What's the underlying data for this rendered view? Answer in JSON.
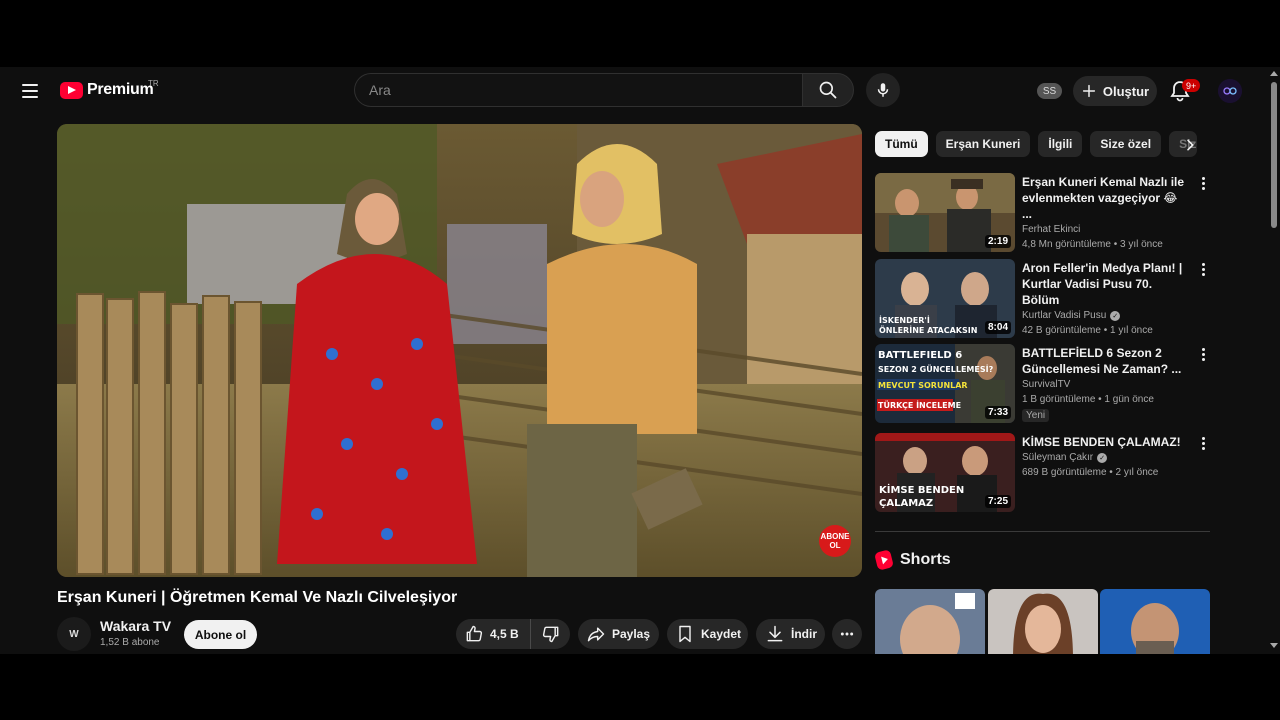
{
  "header": {
    "logo_text": "Premium",
    "country_code": "TR",
    "search_placeholder": "Ara",
    "ss_badge": "SS",
    "create_label": "Oluştur",
    "notification_count": "9+"
  },
  "video": {
    "title": "Erşan Kuneri | Öğretmen Kemal Ve Nazlı Cilveleşiyor",
    "channel_avatar_text": "W",
    "channel_name": "Wakara TV",
    "channel_subs": "1,52 B abone",
    "subscribe_label": "Abone ol",
    "watermark_line1": "ABONE",
    "watermark_line2": "OL",
    "like_count": "4,5 B",
    "share_label": "Paylaş",
    "save_label": "Kaydet",
    "download_label": "İndir"
  },
  "chips": [
    "Tümü",
    "Erşan Kuneri",
    "İlgili",
    "Size özel",
    "Sizin için"
  ],
  "recommendations": [
    {
      "title": "Erşan Kuneri Kemal Nazlı ile evlenmekten vazgeçiyor 😂 ...",
      "channel": "Ferhat Ekinci",
      "verified": false,
      "meta": "4,8 Mn görüntüleme • 3 yıl önce",
      "duration": "2:19",
      "badge": ""
    },
    {
      "title": "Aron Feller'in Medya Planı! | Kurtlar Vadisi Pusu 70. Bölüm",
      "channel": "Kurtlar Vadisi Pusu",
      "verified": true,
      "meta": "42 B görüntüleme • 1 yıl önce",
      "duration": "8:04",
      "badge": "",
      "thumb_text": "İSKENDER'İ ÖNLERİNE ATACAKSIN"
    },
    {
      "title": "BATTLEFİELD 6 Sezon 2 Güncellemesi Ne Zaman? ...",
      "channel": "SurvivalTV",
      "verified": false,
      "meta": "1 B görüntüleme • 1 gün önce",
      "duration": "7:33",
      "badge": "Yeni",
      "thumb_lines": [
        "BATTLEFIELD 6",
        "SEZON 2 GÜNCELLEMESİ?",
        "MEVCUT SORUNLAR",
        "TÜRKÇE İNCELEME"
      ]
    },
    {
      "title": "KİMSE BENDEN ÇALAMAZ!",
      "channel": "Süleyman Çakır",
      "verified": true,
      "meta": "689 B görüntüleme • 2 yıl önce",
      "duration": "7:25",
      "badge": "",
      "thumb_lines": [
        "KİMSE BENDEN",
        "ÇALAMAZ"
      ]
    }
  ],
  "shorts": {
    "title": "Shorts"
  },
  "colors": {
    "background": "#0f0f0f",
    "brand_red": "#ff0033",
    "surface": "#272727",
    "text_secondary": "#aaaaaa"
  }
}
